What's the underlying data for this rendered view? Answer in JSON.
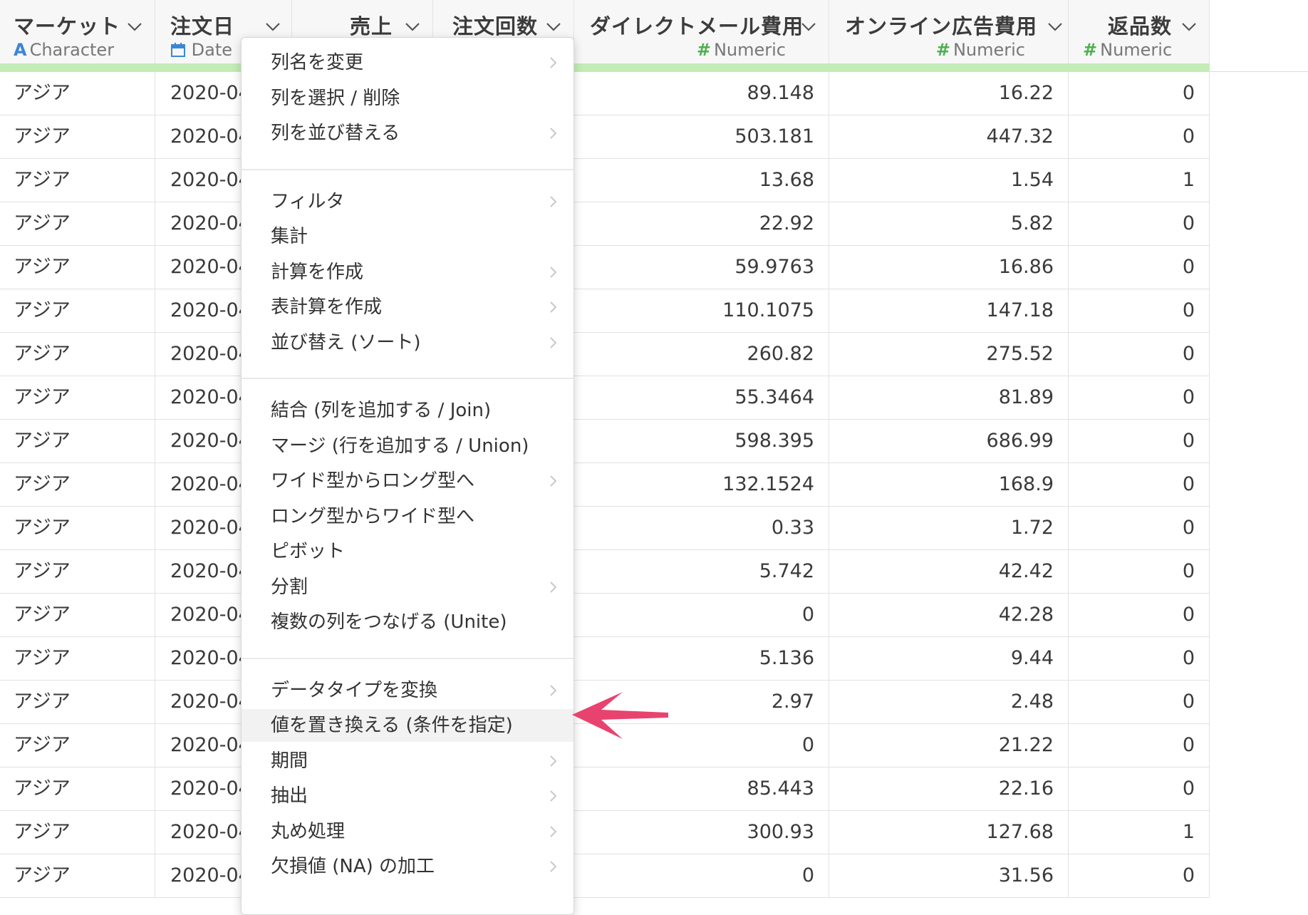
{
  "columns": [
    {
      "name": "マーケット",
      "type_icon": "A",
      "type_label": "Character",
      "icon_kind": "character-type-icon"
    },
    {
      "name": "注文日",
      "type_icon": "calendar",
      "type_label": "Date",
      "icon_kind": "date-type-icon"
    },
    {
      "name": "売上",
      "type_icon": "",
      "type_label": "",
      "icon_kind": ""
    },
    {
      "name": "注文回数",
      "type_icon": "",
      "type_label": "",
      "icon_kind": ""
    },
    {
      "name": "ダイレクトメール費用",
      "type_icon": "#",
      "type_label": "Numeric",
      "icon_kind": "numeric-type-icon"
    },
    {
      "name": "オンライン広告費用",
      "type_icon": "#",
      "type_label": "Numeric",
      "icon_kind": "numeric-type-icon"
    },
    {
      "name": "返品数",
      "type_icon": "#",
      "type_label": "Numeric",
      "icon_kind": "numeric-type-icon"
    }
  ],
  "rows": [
    {
      "market": "アジア",
      "date": "2020-04",
      "dm": "89.148",
      "online": "16.22",
      "returns": "0"
    },
    {
      "market": "アジア",
      "date": "2020-04",
      "dm": "503.181",
      "online": "447.32",
      "returns": "0"
    },
    {
      "market": "アジア",
      "date": "2020-04",
      "dm": "13.68",
      "online": "1.54",
      "returns": "1"
    },
    {
      "market": "アジア",
      "date": "2020-04",
      "dm": "22.92",
      "online": "5.82",
      "returns": "0"
    },
    {
      "market": "アジア",
      "date": "2020-04",
      "dm": "59.9763",
      "online": "16.86",
      "returns": "0"
    },
    {
      "market": "アジア",
      "date": "2020-04",
      "dm": "110.1075",
      "online": "147.18",
      "returns": "0"
    },
    {
      "market": "アジア",
      "date": "2020-04",
      "dm": "260.82",
      "online": "275.52",
      "returns": "0"
    },
    {
      "market": "アジア",
      "date": "2020-04",
      "dm": "55.3464",
      "online": "81.89",
      "returns": "0"
    },
    {
      "market": "アジア",
      "date": "2020-04",
      "dm": "598.395",
      "online": "686.99",
      "returns": "0"
    },
    {
      "market": "アジア",
      "date": "2020-04",
      "dm": "132.1524",
      "online": "168.9",
      "returns": "0"
    },
    {
      "market": "アジア",
      "date": "2020-04",
      "dm": "0.33",
      "online": "1.72",
      "returns": "0"
    },
    {
      "market": "アジア",
      "date": "2020-04",
      "dm": "5.742",
      "online": "42.42",
      "returns": "0"
    },
    {
      "market": "アジア",
      "date": "2020-04",
      "dm": "0",
      "online": "42.28",
      "returns": "0"
    },
    {
      "market": "アジア",
      "date": "2020-04",
      "dm": "5.136",
      "online": "9.44",
      "returns": "0"
    },
    {
      "market": "アジア",
      "date": "2020-04",
      "dm": "2.97",
      "online": "2.48",
      "returns": "0"
    },
    {
      "market": "アジア",
      "date": "2020-04",
      "dm": "0",
      "online": "21.22",
      "returns": "0"
    },
    {
      "market": "アジア",
      "date": "2020-04",
      "dm": "85.443",
      "online": "22.16",
      "returns": "0"
    },
    {
      "market": "アジア",
      "date": "2020-04",
      "dm": "300.93",
      "online": "127.68",
      "returns": "1"
    },
    {
      "market": "アジア",
      "date": "2020-04",
      "dm": "0",
      "online": "31.56",
      "returns": "0"
    }
  ],
  "menu": {
    "groups": [
      [
        {
          "label": "列名を変更",
          "submenu": true,
          "highlighted": false
        },
        {
          "label": "列を選択 / 削除",
          "submenu": false,
          "highlighted": false
        },
        {
          "label": "列を並び替える",
          "submenu": true,
          "highlighted": false
        }
      ],
      [
        {
          "label": "フィルタ",
          "submenu": true,
          "highlighted": false
        },
        {
          "label": "集計",
          "submenu": false,
          "highlighted": false
        },
        {
          "label": "計算を作成",
          "submenu": true,
          "highlighted": false
        },
        {
          "label": "表計算を作成",
          "submenu": true,
          "highlighted": false
        },
        {
          "label": "並び替え (ソート)",
          "submenu": true,
          "highlighted": false
        }
      ],
      [
        {
          "label": "結合 (列を追加する / Join)",
          "submenu": false,
          "highlighted": false
        },
        {
          "label": "マージ (行を追加する / Union)",
          "submenu": false,
          "highlighted": false
        },
        {
          "label": "ワイド型からロング型へ",
          "submenu": true,
          "highlighted": false
        },
        {
          "label": "ロング型からワイド型へ",
          "submenu": false,
          "highlighted": false
        },
        {
          "label": "ピボット",
          "submenu": false,
          "highlighted": false
        },
        {
          "label": "分割",
          "submenu": true,
          "highlighted": false
        },
        {
          "label": "複数の列をつなげる (Unite)",
          "submenu": false,
          "highlighted": false
        }
      ],
      [
        {
          "label": "データタイプを変換",
          "submenu": true,
          "highlighted": false
        },
        {
          "label": "値を置き換える (条件を指定)",
          "submenu": false,
          "highlighted": true
        },
        {
          "label": "期間",
          "submenu": true,
          "highlighted": false
        },
        {
          "label": "抽出",
          "submenu": true,
          "highlighted": false
        },
        {
          "label": "丸め処理",
          "submenu": true,
          "highlighted": false
        },
        {
          "label": "欠損値 (NA) の加工",
          "submenu": true,
          "highlighted": false
        }
      ]
    ]
  },
  "colors": {
    "header_bg": "#f7f7f7",
    "type_bar": "#c4ecb6",
    "character_icon": "#3b86d6",
    "numeric_icon": "#4cb050",
    "annotation_arrow": "#e8436f"
  },
  "annotation": {
    "arrow": "pointing-left-arrow"
  }
}
